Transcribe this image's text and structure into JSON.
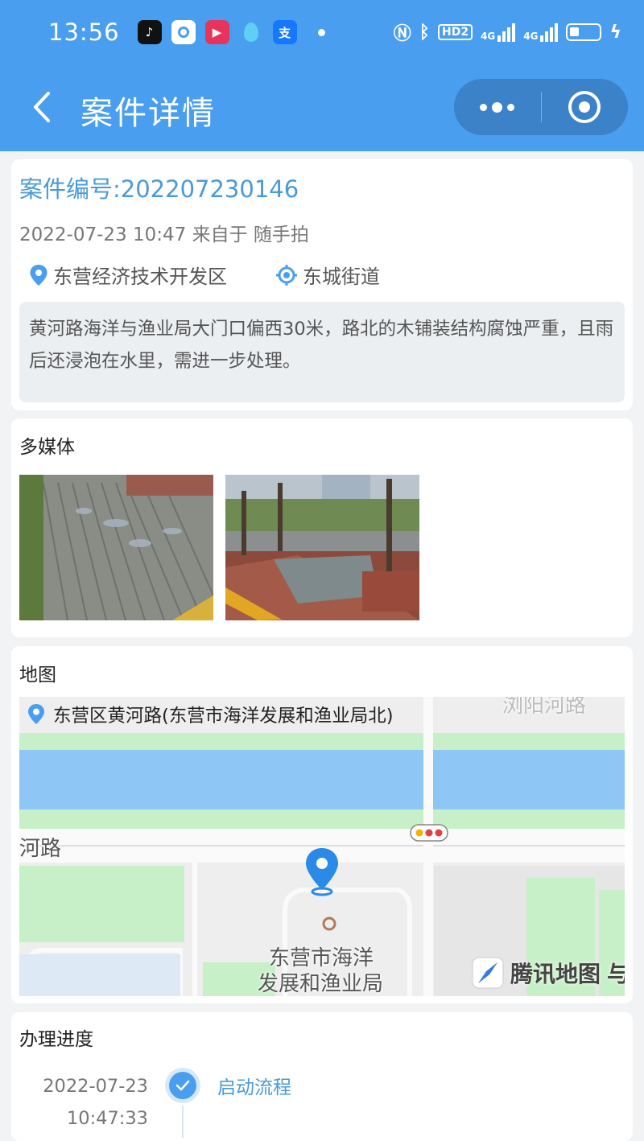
{
  "status_bar": {
    "time": "13:56",
    "hd_badge": "HD2",
    "network_1": "4G",
    "network_2": "4G"
  },
  "navbar": {
    "title": "案件详情"
  },
  "case": {
    "number_label": "案件编号:202207230146",
    "meta": "2022-07-23 10:47 来自于 随手拍",
    "district": "东营经济技术开发区",
    "street": "东城街道",
    "description": "黄河路海洋与渔业局大门口偏西30米，路北的木铺装结构腐蚀严重，且雨后还浸泡在水里，需进一步处理。"
  },
  "media": {
    "title": "多媒体"
  },
  "map": {
    "title": "地图",
    "address": "东营区黄河路(东营市海洋发展和渔业局北)",
    "label_road_top": "浏阳河路",
    "label_road_left": "河路",
    "label_poi_line1": "东营市海洋",
    "label_poi_line2": "发展和渔业局",
    "brand": "腾讯地图",
    "brand_tail": "与"
  },
  "progress": {
    "title": "办理进度",
    "steps": [
      {
        "date": "2022-07-23",
        "time": "10:47:33",
        "label": "启动流程"
      }
    ]
  },
  "colors": {
    "brand_blue": "#4a9ef0",
    "link_blue": "#4a9ad8",
    "page_bg": "#f2f3f5"
  }
}
